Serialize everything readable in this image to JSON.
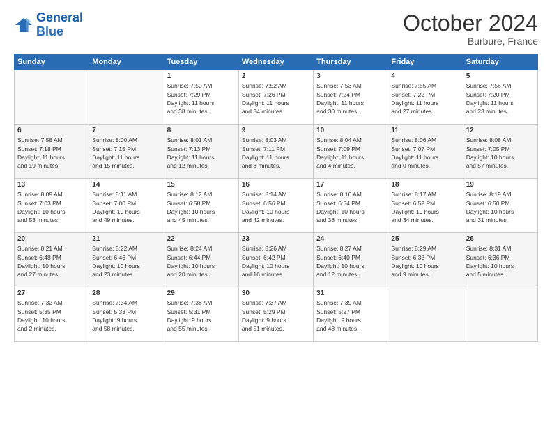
{
  "header": {
    "logo_line1": "General",
    "logo_line2": "Blue",
    "month": "October 2024",
    "location": "Burbure, France"
  },
  "weekdays": [
    "Sunday",
    "Monday",
    "Tuesday",
    "Wednesday",
    "Thursday",
    "Friday",
    "Saturday"
  ],
  "weeks": [
    [
      {
        "day": "",
        "info": ""
      },
      {
        "day": "",
        "info": ""
      },
      {
        "day": "1",
        "info": "Sunrise: 7:50 AM\nSunset: 7:29 PM\nDaylight: 11 hours\nand 38 minutes."
      },
      {
        "day": "2",
        "info": "Sunrise: 7:52 AM\nSunset: 7:26 PM\nDaylight: 11 hours\nand 34 minutes."
      },
      {
        "day": "3",
        "info": "Sunrise: 7:53 AM\nSunset: 7:24 PM\nDaylight: 11 hours\nand 30 minutes."
      },
      {
        "day": "4",
        "info": "Sunrise: 7:55 AM\nSunset: 7:22 PM\nDaylight: 11 hours\nand 27 minutes."
      },
      {
        "day": "5",
        "info": "Sunrise: 7:56 AM\nSunset: 7:20 PM\nDaylight: 11 hours\nand 23 minutes."
      }
    ],
    [
      {
        "day": "6",
        "info": "Sunrise: 7:58 AM\nSunset: 7:18 PM\nDaylight: 11 hours\nand 19 minutes."
      },
      {
        "day": "7",
        "info": "Sunrise: 8:00 AM\nSunset: 7:15 PM\nDaylight: 11 hours\nand 15 minutes."
      },
      {
        "day": "8",
        "info": "Sunrise: 8:01 AM\nSunset: 7:13 PM\nDaylight: 11 hours\nand 12 minutes."
      },
      {
        "day": "9",
        "info": "Sunrise: 8:03 AM\nSunset: 7:11 PM\nDaylight: 11 hours\nand 8 minutes."
      },
      {
        "day": "10",
        "info": "Sunrise: 8:04 AM\nSunset: 7:09 PM\nDaylight: 11 hours\nand 4 minutes."
      },
      {
        "day": "11",
        "info": "Sunrise: 8:06 AM\nSunset: 7:07 PM\nDaylight: 11 hours\nand 0 minutes."
      },
      {
        "day": "12",
        "info": "Sunrise: 8:08 AM\nSunset: 7:05 PM\nDaylight: 10 hours\nand 57 minutes."
      }
    ],
    [
      {
        "day": "13",
        "info": "Sunrise: 8:09 AM\nSunset: 7:03 PM\nDaylight: 10 hours\nand 53 minutes."
      },
      {
        "day": "14",
        "info": "Sunrise: 8:11 AM\nSunset: 7:00 PM\nDaylight: 10 hours\nand 49 minutes."
      },
      {
        "day": "15",
        "info": "Sunrise: 8:12 AM\nSunset: 6:58 PM\nDaylight: 10 hours\nand 45 minutes."
      },
      {
        "day": "16",
        "info": "Sunrise: 8:14 AM\nSunset: 6:56 PM\nDaylight: 10 hours\nand 42 minutes."
      },
      {
        "day": "17",
        "info": "Sunrise: 8:16 AM\nSunset: 6:54 PM\nDaylight: 10 hours\nand 38 minutes."
      },
      {
        "day": "18",
        "info": "Sunrise: 8:17 AM\nSunset: 6:52 PM\nDaylight: 10 hours\nand 34 minutes."
      },
      {
        "day": "19",
        "info": "Sunrise: 8:19 AM\nSunset: 6:50 PM\nDaylight: 10 hours\nand 31 minutes."
      }
    ],
    [
      {
        "day": "20",
        "info": "Sunrise: 8:21 AM\nSunset: 6:48 PM\nDaylight: 10 hours\nand 27 minutes."
      },
      {
        "day": "21",
        "info": "Sunrise: 8:22 AM\nSunset: 6:46 PM\nDaylight: 10 hours\nand 23 minutes."
      },
      {
        "day": "22",
        "info": "Sunrise: 8:24 AM\nSunset: 6:44 PM\nDaylight: 10 hours\nand 20 minutes."
      },
      {
        "day": "23",
        "info": "Sunrise: 8:26 AM\nSunset: 6:42 PM\nDaylight: 10 hours\nand 16 minutes."
      },
      {
        "day": "24",
        "info": "Sunrise: 8:27 AM\nSunset: 6:40 PM\nDaylight: 10 hours\nand 12 minutes."
      },
      {
        "day": "25",
        "info": "Sunrise: 8:29 AM\nSunset: 6:38 PM\nDaylight: 10 hours\nand 9 minutes."
      },
      {
        "day": "26",
        "info": "Sunrise: 8:31 AM\nSunset: 6:36 PM\nDaylight: 10 hours\nand 5 minutes."
      }
    ],
    [
      {
        "day": "27",
        "info": "Sunrise: 7:32 AM\nSunset: 5:35 PM\nDaylight: 10 hours\nand 2 minutes."
      },
      {
        "day": "28",
        "info": "Sunrise: 7:34 AM\nSunset: 5:33 PM\nDaylight: 9 hours\nand 58 minutes."
      },
      {
        "day": "29",
        "info": "Sunrise: 7:36 AM\nSunset: 5:31 PM\nDaylight: 9 hours\nand 55 minutes."
      },
      {
        "day": "30",
        "info": "Sunrise: 7:37 AM\nSunset: 5:29 PM\nDaylight: 9 hours\nand 51 minutes."
      },
      {
        "day": "31",
        "info": "Sunrise: 7:39 AM\nSunset: 5:27 PM\nDaylight: 9 hours\nand 48 minutes."
      },
      {
        "day": "",
        "info": ""
      },
      {
        "day": "",
        "info": ""
      }
    ]
  ]
}
